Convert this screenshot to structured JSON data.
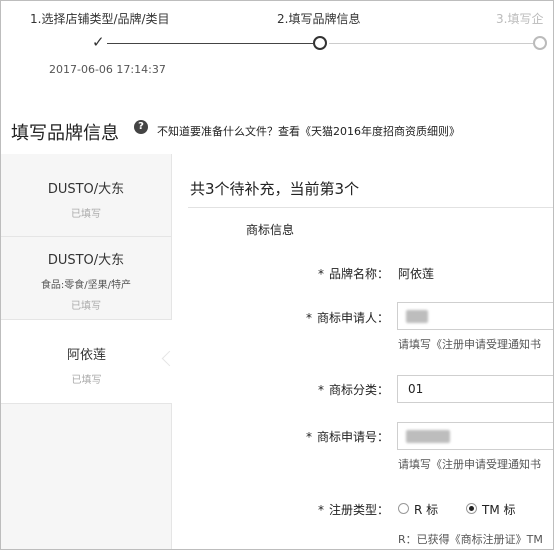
{
  "steps": [
    {
      "label": "1.选择店铺类型/品牌/类目",
      "state": "done"
    },
    {
      "label": "2.填写品牌信息",
      "state": "current"
    },
    {
      "label": "3.填写企",
      "state": "pending"
    }
  ],
  "step_timestamp": "2017-06-06 17:14:37",
  "section": {
    "title": "填写品牌信息",
    "help_text": "不知道要准备什么文件？查看",
    "help_link": "《天猫2016年度招商资质细则》"
  },
  "sidebar": {
    "items": [
      {
        "name": "DUSTO/大东",
        "sub": "",
        "status": "已填写"
      },
      {
        "name": "DUSTO/大东",
        "sub": "食品:零食/坚果/特产",
        "status": "已填写"
      },
      {
        "name": "阿依莲",
        "sub": "",
        "status": "已填写"
      }
    ]
  },
  "main": {
    "title": "共3个待补充，当前第3个",
    "group_title": "商标信息",
    "fields": {
      "brand_name": {
        "label": "品牌名称：",
        "value": "阿依莲"
      },
      "applicant": {
        "label": "商标申请人：",
        "hint": "请填写《注册申请受理通知书"
      },
      "category": {
        "label": "商标分类：",
        "value": "01"
      },
      "reg_no": {
        "label": "商标申请号：",
        "hint": "请填写《注册申请受理通知书"
      },
      "reg_type": {
        "label": "注册类型：",
        "options": [
          "R 标",
          "TM 标"
        ],
        "selected": "TM 标",
        "note": "R：已获得《商标注册证》TM"
      }
    },
    "required_mark": "*"
  }
}
